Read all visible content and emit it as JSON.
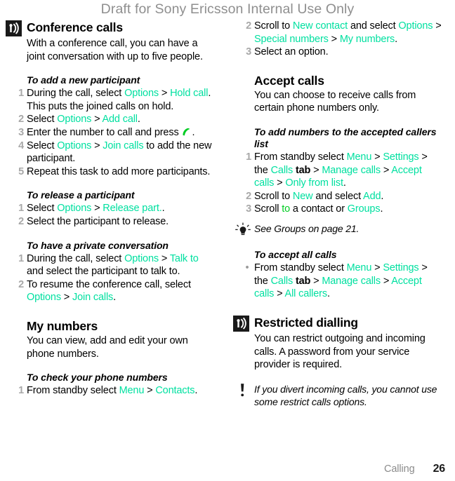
{
  "header": {
    "watermark": "Draft for Sony Ericsson Internal Use Only"
  },
  "footer": {
    "section": "Calling",
    "page_number": "26"
  },
  "colors": {
    "ui_term": "#00e0a0",
    "ui_term_alt": "#00cc22",
    "watermark": "#8f8f8f",
    "list_number": "#a8a8a8",
    "icon_bg": "#1a1a1a"
  },
  "left_column": {
    "section_conference": {
      "icon": "antenna-signal-icon",
      "title": "Conference calls",
      "intro": "With a conference call, you can have a joint conversation with up to five people.",
      "task_add": {
        "title": "To add a new participant",
        "steps": [
          {
            "num": "1",
            "parts": [
              {
                "t": "During the call, select ",
                "k": "plain"
              },
              {
                "t": "Options",
                "k": "ui"
              },
              {
                "t": " > ",
                "k": "plain"
              },
              {
                "t": "Hold call",
                "k": "ui"
              },
              {
                "t": ". This puts the joined calls on hold.",
                "k": "plain"
              }
            ]
          },
          {
            "num": "2",
            "parts": [
              {
                "t": "Select ",
                "k": "plain"
              },
              {
                "t": "Options",
                "k": "ui"
              },
              {
                "t": " > ",
                "k": "plain"
              },
              {
                "t": "Add call",
                "k": "ui"
              },
              {
                "t": ".",
                "k": "plain"
              }
            ]
          },
          {
            "num": "3",
            "parts": [
              {
                "t": "Enter the number to call and press ",
                "k": "plain"
              },
              {
                "t": "",
                "k": "call-icon"
              },
              {
                "t": ".",
                "k": "plain"
              }
            ]
          },
          {
            "num": "4",
            "parts": [
              {
                "t": "Select ",
                "k": "plain"
              },
              {
                "t": "Options",
                "k": "ui"
              },
              {
                "t": " > ",
                "k": "plain"
              },
              {
                "t": "Join calls",
                "k": "ui"
              },
              {
                "t": " to add the new participant.",
                "k": "plain"
              }
            ]
          },
          {
            "num": "5",
            "parts": [
              {
                "t": "Repeat this task to add more participants.",
                "k": "plain"
              }
            ]
          }
        ]
      },
      "task_release": {
        "title": "To release a participant",
        "steps": [
          {
            "num": "1",
            "parts": [
              {
                "t": "Select ",
                "k": "plain"
              },
              {
                "t": "Options",
                "k": "ui"
              },
              {
                "t": " > ",
                "k": "plain"
              },
              {
                "t": "Release part.",
                "k": "ui"
              },
              {
                "t": ".",
                "k": "plain"
              }
            ]
          },
          {
            "num": "2",
            "parts": [
              {
                "t": "Select the participant to release.",
                "k": "plain"
              }
            ]
          }
        ]
      },
      "task_private": {
        "title": "To have a private conversation",
        "steps": [
          {
            "num": "1",
            "parts": [
              {
                "t": "During the call, select ",
                "k": "plain"
              },
              {
                "t": "Options",
                "k": "ui"
              },
              {
                "t": " > ",
                "k": "plain"
              },
              {
                "t": "Talk to",
                "k": "ui"
              },
              {
                "t": " and select the participant to talk to.",
                "k": "plain"
              }
            ]
          },
          {
            "num": "2",
            "parts": [
              {
                "t": "To resume the conference call, select ",
                "k": "plain"
              },
              {
                "t": "Options",
                "k": "ui"
              },
              {
                "t": " > ",
                "k": "plain"
              },
              {
                "t": "Join calls",
                "k": "ui"
              },
              {
                "t": ".",
                "k": "plain"
              }
            ]
          }
        ]
      }
    },
    "section_my_numbers": {
      "title": "My numbers",
      "intro": "You can view, add and edit your own phone numbers.",
      "task_check": {
        "title": "To check your phone numbers",
        "steps": [
          {
            "num": "1",
            "parts": [
              {
                "t": "From standby select ",
                "k": "plain"
              },
              {
                "t": "Menu",
                "k": "ui"
              },
              {
                "t": " > ",
                "k": "plain"
              },
              {
                "t": "Contacts",
                "k": "ui"
              },
              {
                "t": ".",
                "k": "plain"
              }
            ]
          }
        ]
      }
    }
  },
  "right_column": {
    "continued_steps": [
      {
        "num": "2",
        "parts": [
          {
            "t": "Scroll to ",
            "k": "plain"
          },
          {
            "t": "New contact",
            "k": "ui"
          },
          {
            "t": " and select ",
            "k": "plain"
          },
          {
            "t": "Options",
            "k": "ui"
          },
          {
            "t": " > ",
            "k": "plain"
          },
          {
            "t": "Special numbers",
            "k": "ui"
          },
          {
            "t": " > ",
            "k": "plain"
          },
          {
            "t": "My numbers",
            "k": "ui"
          },
          {
            "t": ".",
            "k": "plain"
          }
        ]
      },
      {
        "num": "3",
        "parts": [
          {
            "t": "Select an option.",
            "k": "plain"
          }
        ]
      }
    ],
    "section_accept": {
      "title": "Accept calls",
      "intro": "You can choose to receive calls from certain phone numbers only.",
      "task_add_numbers": {
        "title": "To add numbers to the accepted callers list",
        "steps": [
          {
            "num": "1",
            "parts": [
              {
                "t": "From standby select ",
                "k": "plain"
              },
              {
                "t": "Menu",
                "k": "ui"
              },
              {
                "t": " > ",
                "k": "plain"
              },
              {
                "t": "Settings",
                "k": "ui"
              },
              {
                "t": " > the ",
                "k": "plain"
              },
              {
                "t": "Calls",
                "k": "ui"
              },
              {
                "t": " tab",
                "k": "bold"
              },
              {
                "t": " > ",
                "k": "plain"
              },
              {
                "t": "Manage calls",
                "k": "ui"
              },
              {
                "t": " > ",
                "k": "plain"
              },
              {
                "t": "Accept calls",
                "k": "ui"
              },
              {
                "t": " > ",
                "k": "plain"
              },
              {
                "t": "Only from list",
                "k": "ui"
              },
              {
                "t": ".",
                "k": "plain"
              }
            ]
          },
          {
            "num": "2",
            "parts": [
              {
                "t": "Scroll to ",
                "k": "plain"
              },
              {
                "t": "New",
                "k": "ui"
              },
              {
                "t": " and select ",
                "k": "plain"
              },
              {
                "t": "Add",
                "k": "ui"
              },
              {
                "t": ".",
                "k": "plain"
              }
            ]
          },
          {
            "num": "3",
            "parts": [
              {
                "t": "Scroll ",
                "k": "plain"
              },
              {
                "t": "to",
                "k": "ui-green"
              },
              {
                "t": " a contact or ",
                "k": "plain"
              },
              {
                "t": "Groups",
                "k": "ui"
              },
              {
                "t": ".",
                "k": "plain"
              }
            ]
          }
        ]
      },
      "tip": {
        "icon": "lightbulb-tip-icon",
        "text": "See Groups on page 21."
      },
      "task_accept_all": {
        "title": "To accept all calls",
        "steps": [
          {
            "num": "•",
            "bullet": true,
            "parts": [
              {
                "t": "From standby select ",
                "k": "plain"
              },
              {
                "t": "Menu",
                "k": "ui"
              },
              {
                "t": " > ",
                "k": "plain"
              },
              {
                "t": "Settings",
                "k": "ui"
              },
              {
                "t": " > the ",
                "k": "plain"
              },
              {
                "t": "Calls",
                "k": "ui"
              },
              {
                "t": " tab",
                "k": "bold"
              },
              {
                "t": " > ",
                "k": "plain"
              },
              {
                "t": "Manage calls",
                "k": "ui"
              },
              {
                "t": " > ",
                "k": "plain"
              },
              {
                "t": "Accept calls",
                "k": "ui"
              },
              {
                "t": " > ",
                "k": "plain"
              },
              {
                "t": "All callers",
                "k": "ui"
              },
              {
                "t": ".",
                "k": "plain"
              }
            ]
          }
        ]
      }
    },
    "section_restricted": {
      "icon": "antenna-signal-icon",
      "title": "Restricted dialling",
      "intro": "You can restrict outgoing and incoming calls. A password from your service provider is required.",
      "warning": {
        "icon": "exclamation-note-icon",
        "text": "If you divert incoming calls, you cannot use some restrict calls options."
      }
    }
  }
}
